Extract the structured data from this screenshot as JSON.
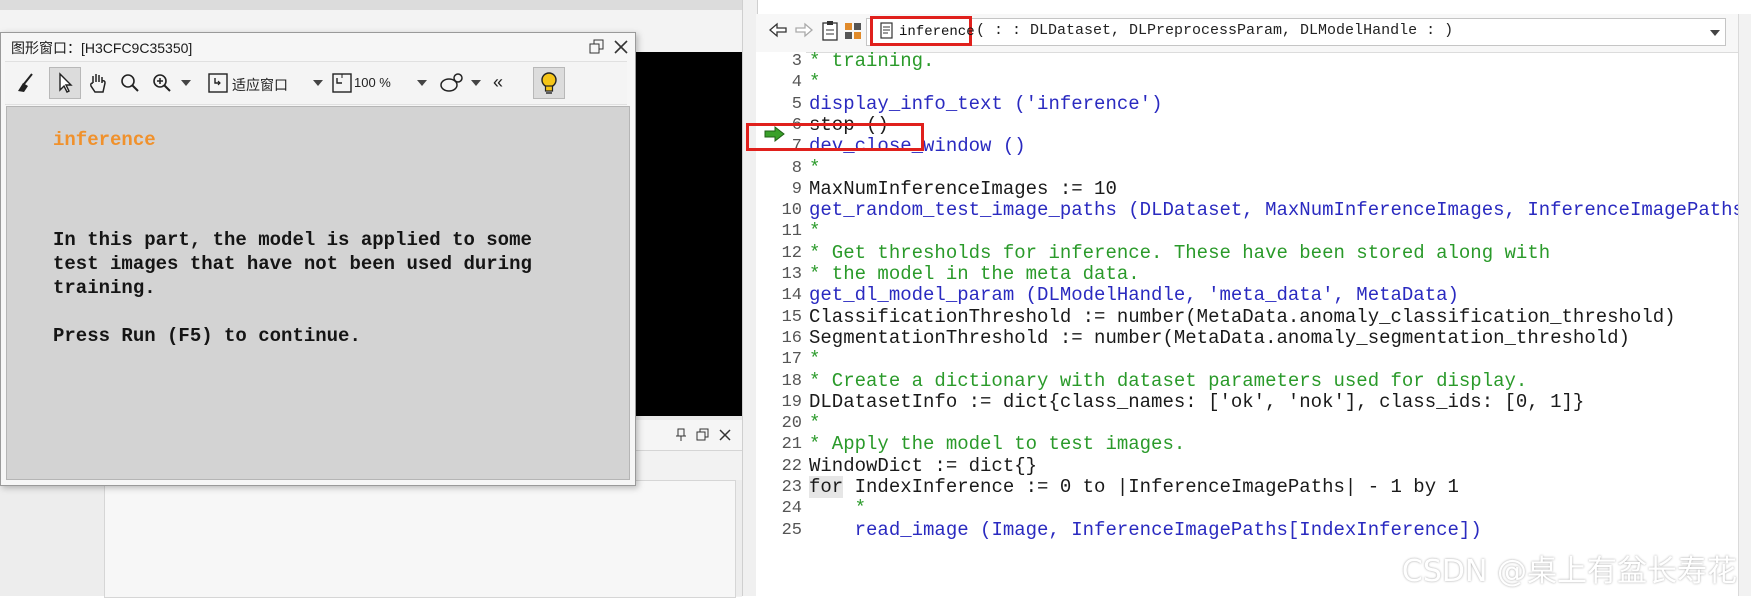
{
  "graphics_window": {
    "title": "图形窗口：[H3CFC9C35350]",
    "toolbar": {
      "fit_window_label": "适应窗口",
      "zoom_value": "100 %",
      "collapse_label": "«"
    },
    "message": {
      "heading": "inference",
      "lines": [
        "In this part, the model is applied to some",
        "test images that have not been used during",
        "training.",
        "",
        "Press Run (F5) to continue."
      ]
    }
  },
  "editor": {
    "procedure_name": "inference",
    "procedure_signature": "( : : DLDataset, DLPreprocessParam, DLModelHandle : )",
    "current_line": 6,
    "lines": [
      {
        "n": 3,
        "text": "* training."
      },
      {
        "n": 4,
        "text": "*"
      },
      {
        "n": 5,
        "text": "display_info_text ('inference')"
      },
      {
        "n": 6,
        "text": "stop ()"
      },
      {
        "n": 7,
        "text": "dev_close_window ()"
      },
      {
        "n": 8,
        "text": "*"
      },
      {
        "n": 9,
        "text": "MaxNumInferenceImages := 10"
      },
      {
        "n": 10,
        "text": "get_random_test_image_paths (DLDataset, MaxNumInferenceImages, InferenceImagePaths)"
      },
      {
        "n": 11,
        "text": "*"
      },
      {
        "n": 12,
        "text": "* Get thresholds for inference. These have been stored along with"
      },
      {
        "n": 13,
        "text": "* the model in the meta data."
      },
      {
        "n": 14,
        "text": "get_dl_model_param (DLModelHandle, 'meta_data', MetaData)"
      },
      {
        "n": 15,
        "text": "ClassificationThreshold := number(MetaData.anomaly_classification_threshold)"
      },
      {
        "n": 16,
        "text": "SegmentationThreshold := number(MetaData.anomaly_segmentation_threshold)"
      },
      {
        "n": 17,
        "text": "*"
      },
      {
        "n": 18,
        "text": "* Create a dictionary with dataset parameters used for display."
      },
      {
        "n": 19,
        "text": "DLDatasetInfo := dict{class_names: ['ok', 'nok'], class_ids: [0, 1]}"
      },
      {
        "n": 20,
        "text": "*"
      },
      {
        "n": 21,
        "text": "* Apply the model to test images."
      },
      {
        "n": 22,
        "text": "WindowDict := dict{}"
      },
      {
        "n": 23,
        "text": "for IndexInference := 0 to |InferenceImagePaths| - 1 by 1"
      },
      {
        "n": 24,
        "text": "    *"
      },
      {
        "n": 25,
        "text": "    read_image (Image, InferenceImagePaths[IndexInference])"
      }
    ]
  },
  "watermark": "CSDN @桌上有盆长寿花",
  "colors": {
    "highlight_red": "#e0201c",
    "heading_orange": "#f0912c",
    "comment_green": "#2a9a2a",
    "operator_blue": "#2a2ac0"
  }
}
